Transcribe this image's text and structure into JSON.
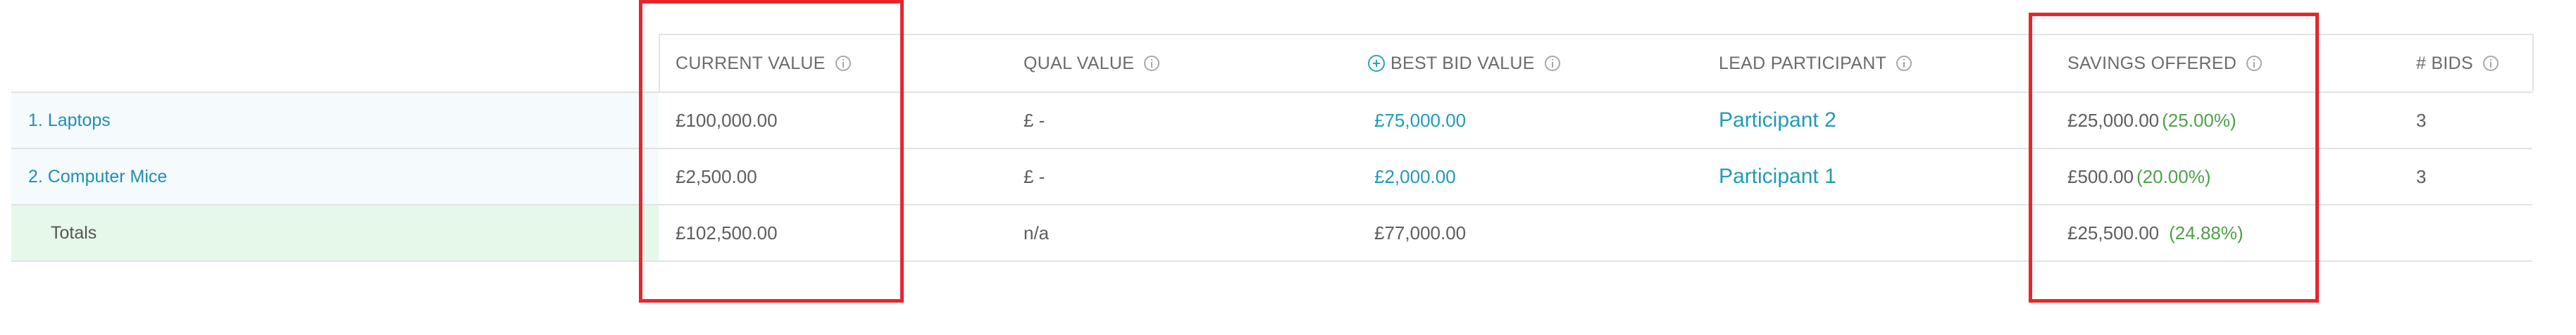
{
  "colors": {
    "accent": "#1f9bb7",
    "positive": "#4da14a",
    "highlight": "#e5262c",
    "label_bg": "#f5fafc",
    "totals_bg": "#e6f8ea"
  },
  "columns": {
    "current_value": "CURRENT VALUE",
    "qual_value": "QUAL VALUE",
    "best_bid_value": "BEST BID VALUE",
    "lead_participant": "LEAD PARTICIPANT",
    "savings_offered": "SAVINGS OFFERED",
    "bids": "# BIDS"
  },
  "icons": {
    "info": "info-icon",
    "best_bid": "plus-circle-icon"
  },
  "rows": [
    {
      "label": "1. Laptops",
      "current_value": "£100,000.00",
      "qual_value": "£ -",
      "best_bid_value": "£75,000.00",
      "lead_participant": "Participant 2",
      "savings_amount": "£25,000.00",
      "savings_pct": "(25.00%)",
      "bids": "3"
    },
    {
      "label": "2. Computer Mice",
      "current_value": "£2,500.00",
      "qual_value": "£ -",
      "best_bid_value": "£2,000.00",
      "lead_participant": "Participant 1",
      "savings_amount": "£500.00",
      "savings_pct": "(20.00%)",
      "bids": "3"
    }
  ],
  "totals": {
    "label": "Totals",
    "current_value": "£102,500.00",
    "qual_value": "n/a",
    "best_bid_value": "£77,000.00",
    "savings_amount": "£25,500.00",
    "savings_pct": "(24.88%)"
  }
}
